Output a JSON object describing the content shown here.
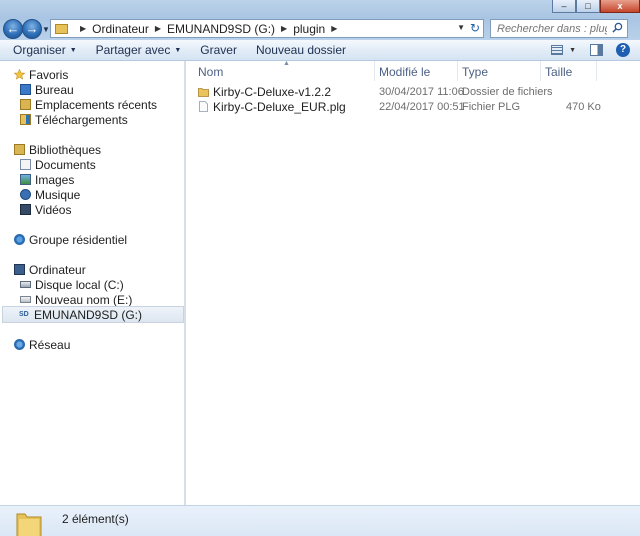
{
  "window": {
    "controls": {
      "minimize": "–",
      "maximize": "□",
      "close": "x"
    }
  },
  "navigation": {
    "back_glyph": "←",
    "forward_glyph": "→",
    "breadcrumb": [
      "Ordinateur",
      "EMUNAND9SD (G:)",
      "plugin"
    ],
    "refresh_glyph": "↻",
    "search_placeholder": "Rechercher dans : plugin"
  },
  "toolbar": {
    "organize_label": "Organiser",
    "share_label": "Partager avec",
    "burn_label": "Graver",
    "new_folder_label": "Nouveau dossier",
    "help_glyph": "?"
  },
  "sidebar": {
    "favorites": {
      "label": "Favoris",
      "items": [
        {
          "label": "Bureau"
        },
        {
          "label": "Emplacements récents"
        },
        {
          "label": "Téléchargements"
        }
      ]
    },
    "libraries": {
      "label": "Bibliothèques",
      "items": [
        {
          "label": "Documents"
        },
        {
          "label": "Images"
        },
        {
          "label": "Musique"
        },
        {
          "label": "Vidéos"
        }
      ]
    },
    "homegroup": {
      "label": "Groupe résidentiel"
    },
    "computer": {
      "label": "Ordinateur",
      "items": [
        {
          "label": "Disque local (C:)"
        },
        {
          "label": "Nouveau nom (E:)"
        },
        {
          "label": "EMUNAND9SD (G:)"
        }
      ]
    },
    "network": {
      "label": "Réseau"
    }
  },
  "file_list": {
    "columns": {
      "name": "Nom",
      "modified": "Modifié le",
      "type": "Type",
      "size": "Taille"
    },
    "rows": [
      {
        "name": "Kirby-C-Deluxe-v1.2.2",
        "modified": "30/04/2017 11:06",
        "type": "Dossier de fichiers",
        "size": ""
      },
      {
        "name": "Kirby-C-Deluxe_EUR.plg",
        "modified": "22/04/2017 00:51",
        "type": "Fichier PLG",
        "size": "470 Ko"
      }
    ]
  },
  "status": {
    "item_count": "2 élément(s)"
  },
  "colors": {
    "accent": "#2f70b7",
    "folder": "#e7c25a"
  }
}
